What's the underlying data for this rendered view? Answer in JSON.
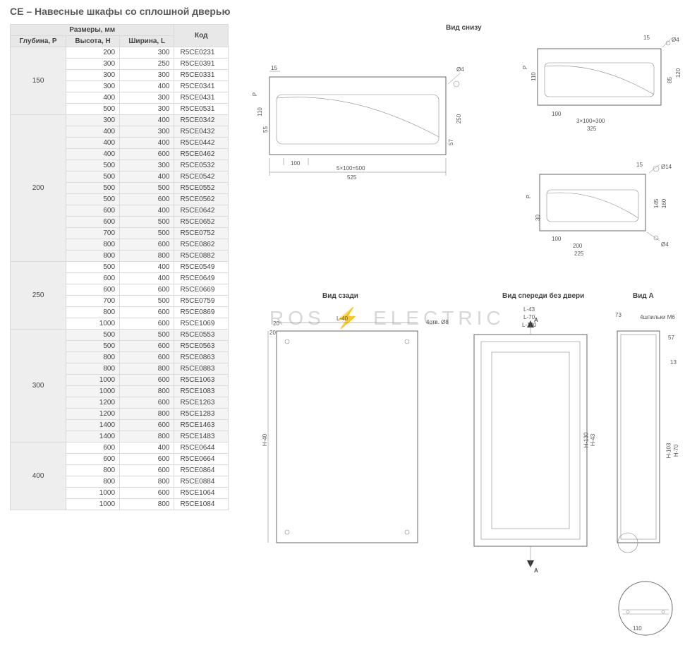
{
  "title": "CE – Навесные шкафы со сплошной дверью",
  "headers": {
    "dims": "Размеры, мм",
    "depth": "Глубина, P",
    "height": "Высота, H",
    "width": "Ширина, L",
    "code": "Код"
  },
  "groups": [
    {
      "depth": "150",
      "shade": false,
      "rows": [
        {
          "h": "200",
          "w": "300",
          "code": "R5CE0231"
        },
        {
          "h": "300",
          "w": "250",
          "code": "R5CE0391"
        },
        {
          "h": "300",
          "w": "300",
          "code": "R5CE0331"
        },
        {
          "h": "300",
          "w": "400",
          "code": "R5CE0341"
        },
        {
          "h": "400",
          "w": "300",
          "code": "R5CE0431"
        },
        {
          "h": "500",
          "w": "300",
          "code": "R5CE0531"
        }
      ]
    },
    {
      "depth": "200",
      "shade": true,
      "rows": [
        {
          "h": "300",
          "w": "400",
          "code": "R5CE0342"
        },
        {
          "h": "400",
          "w": "300",
          "code": "R5CE0432"
        },
        {
          "h": "400",
          "w": "400",
          "code": "R5CE0442"
        },
        {
          "h": "400",
          "w": "600",
          "code": "R5CE0462"
        },
        {
          "h": "500",
          "w": "300",
          "code": "R5CE0532"
        },
        {
          "h": "500",
          "w": "400",
          "code": "R5CE0542"
        },
        {
          "h": "500",
          "w": "500",
          "code": "R5CE0552"
        },
        {
          "h": "500",
          "w": "600",
          "code": "R5CE0562"
        },
        {
          "h": "600",
          "w": "400",
          "code": "R5CE0642"
        },
        {
          "h": "600",
          "w": "500",
          "code": "R5CE0652"
        },
        {
          "h": "700",
          "w": "500",
          "code": "R5CE0752"
        },
        {
          "h": "800",
          "w": "600",
          "code": "R5CE0862"
        },
        {
          "h": "800",
          "w": "800",
          "code": "R5CE0882"
        }
      ]
    },
    {
      "depth": "250",
      "shade": false,
      "rows": [
        {
          "h": "500",
          "w": "400",
          "code": "R5CE0549"
        },
        {
          "h": "600",
          "w": "400",
          "code": "R5CE0649"
        },
        {
          "h": "600",
          "w": "600",
          "code": "R5CE0669"
        },
        {
          "h": "700",
          "w": "500",
          "code": "R5CE0759"
        },
        {
          "h": "800",
          "w": "600",
          "code": "R5CE0869"
        },
        {
          "h": "1000",
          "w": "600",
          "code": "R5CE1069"
        }
      ]
    },
    {
      "depth": "300",
      "shade": true,
      "rows": [
        {
          "h": "500",
          "w": "500",
          "code": "R5CE0553"
        },
        {
          "h": "500",
          "w": "600",
          "code": "R5CE0563"
        },
        {
          "h": "800",
          "w": "600",
          "code": "R5CE0863"
        },
        {
          "h": "800",
          "w": "800",
          "code": "R5CE0883"
        },
        {
          "h": "1000",
          "w": "600",
          "code": "R5CE1063"
        },
        {
          "h": "1000",
          "w": "800",
          "code": "R5CE1083"
        },
        {
          "h": "1200",
          "w": "600",
          "code": "R5CE1263"
        },
        {
          "h": "1200",
          "w": "800",
          "code": "R5CE1283"
        },
        {
          "h": "1400",
          "w": "600",
          "code": "R5CE1463"
        },
        {
          "h": "1400",
          "w": "800",
          "code": "R5CE1483"
        }
      ]
    },
    {
      "depth": "400",
      "shade": false,
      "rows": [
        {
          "h": "600",
          "w": "400",
          "code": "R5CE0644"
        },
        {
          "h": "600",
          "w": "600",
          "code": "R5CE0664"
        },
        {
          "h": "800",
          "w": "600",
          "code": "R5CE0864"
        },
        {
          "h": "800",
          "w": "800",
          "code": "R5CE0884"
        },
        {
          "h": "1000",
          "w": "600",
          "code": "R5CE1064"
        },
        {
          "h": "1000",
          "w": "800",
          "code": "R5CE1084"
        }
      ]
    }
  ],
  "labels": {
    "bottom_view": "Вид снизу",
    "rear_view": "Вид сзади",
    "front_no_door": "Вид спереди без двери",
    "view_a": "Вид А"
  },
  "dims": {
    "d15_a": "15",
    "d15_b": "15",
    "d15_c": "15",
    "d4_a": "Ø4",
    "d4_b": "Ø4",
    "d14": "Ø14",
    "d110": "110",
    "d110b": "110",
    "d55": "55",
    "d100": "100",
    "d100b": "100",
    "d100c": "100",
    "d5x100": "5×100=500",
    "d525": "525",
    "d250": "250",
    "d57": "57",
    "d3x100": "3×100=300",
    "d325": "325",
    "d85": "85",
    "d120": "120",
    "d30": "30",
    "d200": "200",
    "d225": "225",
    "d145": "145",
    "d160": "160",
    "d20": "20",
    "dL40": "L-40",
    "d4holes": "4отв. Ø8",
    "dH40": "H-40",
    "dL43": "L-43",
    "dL70": "L-70",
    "dL130": "L-130",
    "dH43": "H-43",
    "dH130": "H-130",
    "dA": "A",
    "dA2": "A",
    "d73": "73",
    "dpins": "4шпильки M6",
    "d57b": "57",
    "d13": "13",
    "dH103": "H-103",
    "dH70": "H-70",
    "d110c": "110",
    "dP": "P"
  },
  "watermark": "ROS ⚡ ELECTRIC"
}
